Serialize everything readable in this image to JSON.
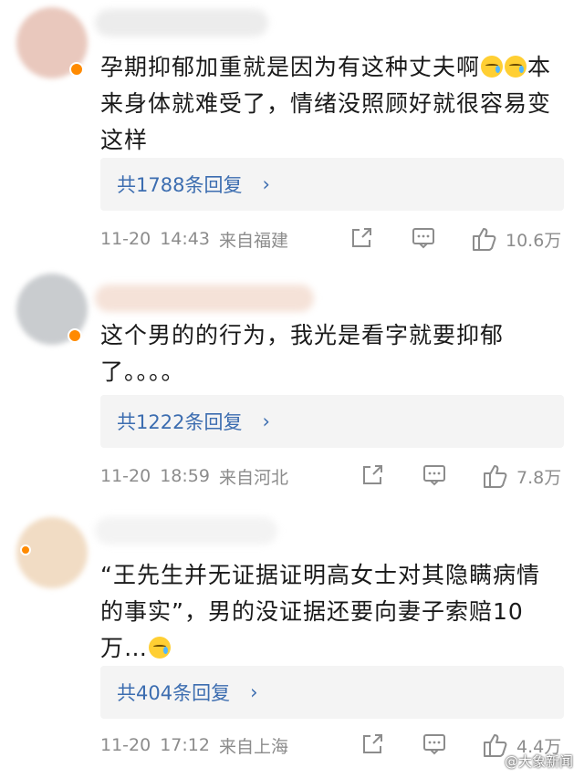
{
  "comments": [
    {
      "text_lines": [
        "孕期抑郁加重就是因为有这种丈夫啊",
        "来身体就难受了，情绪没照顾好就很容易变",
        "这样"
      ],
      "text_line1_suffix": "本",
      "reply_label": "共1788条回复",
      "date": "11-20",
      "time": "14:43",
      "location": "来自福建",
      "likes": "10.6万",
      "avatar_color": "#e9c8bd"
    },
    {
      "text_lines": [
        "这个男的的行为，我光是看字就要抑郁",
        "了。。。。"
      ],
      "reply_label": "共1222条回复",
      "date": "11-20",
      "time": "18:59",
      "location": "来自河北",
      "likes": "7.8万",
      "avatar_color": "#c9cccf"
    },
    {
      "text_lines": [
        "“王先生并无证据证明高女士对其隐瞒病情",
        "的事实”，男的没证据还要向妻子索赔10",
        "万…"
      ],
      "reply_label": "共404条回复",
      "date": "11-20",
      "time": "17:12",
      "location": "来自上海",
      "likes": "4.4万",
      "avatar_color": "#f1dcc4"
    }
  ],
  "icons": {
    "reply_arrow": "›",
    "share_icon": "share-icon",
    "comment_icon": "comment-icon",
    "like_icon": "thumbs-up-icon"
  },
  "watermark": "@大象新闻",
  "colors": {
    "link": "#3c6db0",
    "meta": "#8c8c8c",
    "reply_bg": "#f4f4f4"
  }
}
